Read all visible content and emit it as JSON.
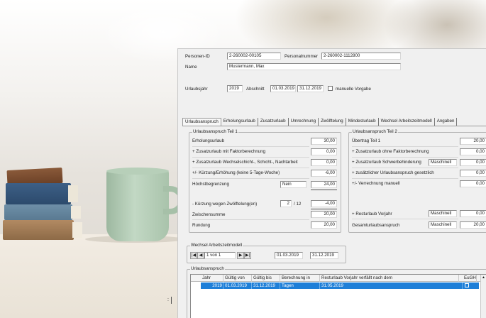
{
  "header": {
    "personen_id_label": "Personen-ID",
    "personen_id": "2-260002-00105",
    "personalnummer_label": "Personalnummer",
    "personalnummer": "2-260002-1112800",
    "name_label": "Name",
    "name": "Mustermann, Max",
    "urlaubsjahr_label": "Urlaubsjahr",
    "urlaubsjahr": "2019",
    "abschnitt_label": "Abschnitt",
    "abschnitt_von": "01.03.2019",
    "abschnitt_bis": "31.12.2019",
    "manuelle_vorgabe_label": "manuelle Vorgabe"
  },
  "tabs": [
    {
      "label": "Urlaubsanspruch",
      "active": true
    },
    {
      "label": "Erholungsurlaub"
    },
    {
      "label": "Zusatzurlaub"
    },
    {
      "label": "Umrechnung"
    },
    {
      "label": "Zwölftelung"
    },
    {
      "label": "Mindesturlaub"
    },
    {
      "label": "Wechsel Arbeitszeitmodell"
    },
    {
      "label": "Angaben"
    }
  ],
  "teil1": {
    "title": "Urlaubsanspruch Teil 1",
    "rows": [
      {
        "label": "Erholungsurlaub",
        "value": "30,00"
      },
      {
        "label": "+ Zusatzurlaub mit Faktorberechnung",
        "value": "0,00"
      },
      {
        "label": "+ Zusatzurlaub Wechselschicht-, Schicht-, Nachtarbeit",
        "value": "0,00"
      },
      {
        "label": "+/- Kürzung/Erhöhung (keine 5-Tage-Woche)",
        "value": "-6,00"
      },
      {
        "label": "Höchstbegrenzung",
        "mode": "Nein",
        "value": "24,00"
      },
      {
        "label": "- Kürzung wegen Zwölftelung(en)",
        "count": "2",
        "of": "/ 12",
        "value": "-4,00"
      },
      {
        "label": "Zwischensumme",
        "value": "20,00"
      },
      {
        "label": "Rundung",
        "value": "20,00"
      }
    ]
  },
  "teil2": {
    "title": "Urlaubsanspruch Teil 2",
    "rows": [
      {
        "label": "Übertrag Teil 1",
        "value": "20,00"
      },
      {
        "label": "+ Zusatzurlaub ohne Faktorberechnung",
        "value": "0,00"
      },
      {
        "label": "+ Zusatzurlaub Schwerbehinderung",
        "mode": "Maschinell",
        "value": "0,00"
      },
      {
        "label": "+ zusätzlicher Urlaubsanspruch gesetzlich",
        "value": "0,00"
      },
      {
        "label": "+/- Verrechnung manuell",
        "value": "0,00"
      },
      {
        "label": "+ Resturlaub Vorjahr",
        "mode": "Maschinell",
        "value": "0,00"
      },
      {
        "label": "Gesamturlaubsanspruch",
        "mode": "Maschinell",
        "value": "20,00"
      }
    ]
  },
  "wechsel": {
    "title": "Wechsel Arbeitszeitmodell",
    "pager_text": "1 von 1",
    "von": "01.03.2019",
    "bis": "31.12.2019"
  },
  "urlaubsanspruch_table": {
    "title": "Urlaubsanspruch",
    "columns": [
      "Jahr",
      "Gültig von",
      "Gültig bis",
      "Berechnung in",
      "Resturlaub Vorjahr verfällt nach dem",
      "EuGH"
    ],
    "rows": [
      {
        "jahr": "2019",
        "gueltig_von": "01.03.2019",
        "gueltig_bis": "31.12.2019",
        "berechnung": "Tagen",
        "verfall": "31.05.2019"
      }
    ]
  },
  "colors": {
    "selection": "#1e7fd8",
    "window": "#f0f0f0"
  }
}
